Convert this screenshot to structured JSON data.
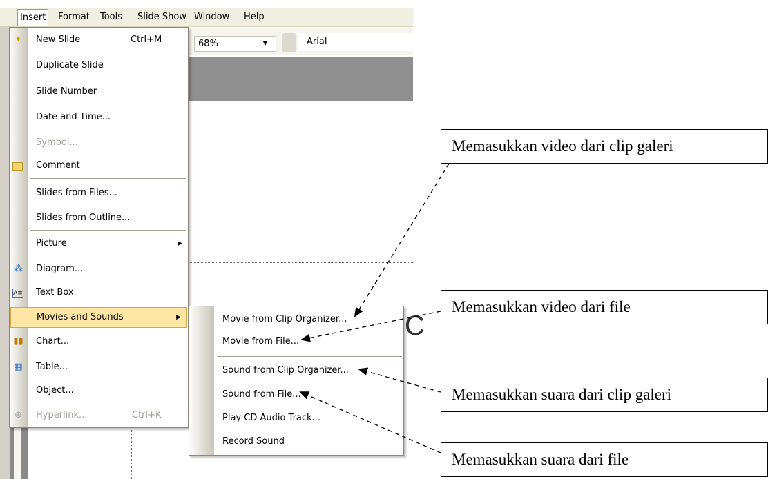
{
  "menubar": {
    "items": [
      "Insert",
      "Format",
      "Tools",
      "Slide Show",
      "Window",
      "Help"
    ]
  },
  "toolbar": {
    "zoom_value": "68%",
    "font_value": "Arial"
  },
  "insert_menu": {
    "items": [
      {
        "label": "New Slide",
        "shortcut": "Ctrl+M",
        "icon": "new-slide-icon"
      },
      {
        "label": "Duplicate Slide"
      },
      {
        "label": "Slide Number"
      },
      {
        "label": "Date and Time..."
      },
      {
        "label": "Symbol...",
        "disabled": true
      },
      {
        "label": "Comment",
        "icon": "comment-icon"
      },
      {
        "label": "Slides from Files..."
      },
      {
        "label": "Slides from Outline..."
      },
      {
        "label": "Picture",
        "submenu": true
      },
      {
        "label": "Diagram...",
        "icon": "diagram-icon"
      },
      {
        "label": "Text Box",
        "icon": "text-box-icon"
      },
      {
        "label": "Movies and Sounds",
        "submenu": true,
        "highlighted": true
      },
      {
        "label": "Chart...",
        "icon": "chart-icon"
      },
      {
        "label": "Table...",
        "icon": "table-icon"
      },
      {
        "label": "Object..."
      },
      {
        "label": "Hyperlink...",
        "shortcut": "Ctrl+K",
        "disabled": true,
        "icon": "hyperlink-icon"
      }
    ]
  },
  "movies_submenu": {
    "items": [
      {
        "label": "Movie from Clip Organizer..."
      },
      {
        "label": "Movie from File..."
      },
      {
        "label": "Sound from Clip Organizer..."
      },
      {
        "label": "Sound from File..."
      },
      {
        "label": "Play CD Audio Track..."
      },
      {
        "label": "Record Sound"
      }
    ]
  },
  "callouts": {
    "video_clip": "Memasukkan video dari clip galeri",
    "video_file": "Memasukkan video dari file",
    "sound_clip": "Memasukkan suara dari clip galeri",
    "sound_file": "Memasukkan suara dari file"
  },
  "colors": {
    "highlight": "#fde6a4",
    "menubar": "#f1efe2"
  }
}
